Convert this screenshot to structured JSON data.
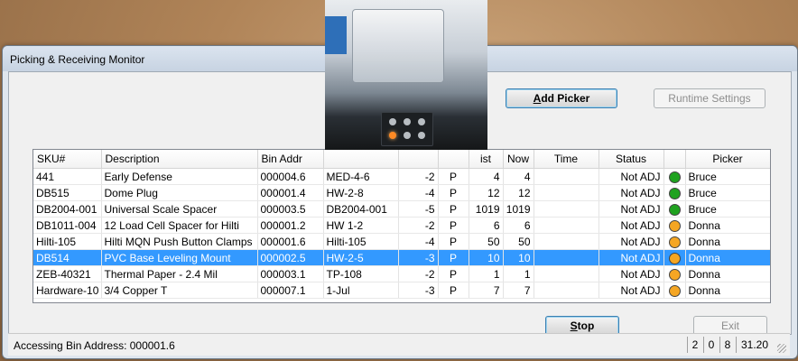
{
  "window": {
    "title": "Picking & Receiving Monitor"
  },
  "buttons": {
    "add_picker": "Add Picker",
    "runtime_settings": "Runtime Settings",
    "stop": "Stop",
    "exit": "Exit"
  },
  "grid": {
    "headers": [
      "SKU#",
      "Description",
      "Bin Addr",
      "",
      "",
      "",
      "ist",
      "Now",
      "Time",
      "Status",
      "",
      "Picker"
    ],
    "rows": [
      {
        "sku": "441",
        "desc": "Early Defense",
        "bin": "000004.6",
        "loc": "MED-4-6",
        "qty": "-2",
        "type": "P",
        "last": "4",
        "now": "4",
        "time": "",
        "status": "Not ADJ",
        "light": "green",
        "picker": "Bruce"
      },
      {
        "sku": "DB515",
        "desc": "Dome Plug",
        "bin": "000001.4",
        "loc": "HW-2-8",
        "qty": "-4",
        "type": "P",
        "last": "12",
        "now": "12",
        "time": "",
        "status": "Not ADJ",
        "light": "green",
        "picker": "Bruce"
      },
      {
        "sku": "DB2004-001",
        "desc": "Universal Scale Spacer",
        "bin": "000003.5",
        "loc": "DB2004-001",
        "qty": "-5",
        "type": "P",
        "last": "1019",
        "now": "1019",
        "time": "",
        "status": "Not ADJ",
        "light": "green",
        "picker": "Bruce"
      },
      {
        "sku": "DB1011-004",
        "desc": "12 Load Cell Spacer for Hilti",
        "bin": "000001.2",
        "loc": "HW 1-2",
        "qty": "-2",
        "type": "P",
        "last": "6",
        "now": "6",
        "time": "",
        "status": "Not ADJ",
        "light": "orange",
        "picker": "Donna"
      },
      {
        "sku": "Hilti-105",
        "desc": "Hilti MQN Push Button Clamps",
        "bin": "000001.6",
        "loc": "Hilti-105",
        "qty": "-4",
        "type": "P",
        "last": "50",
        "now": "50",
        "time": "",
        "status": "Not ADJ",
        "light": "orange",
        "picker": "Donna"
      },
      {
        "sku": "DB514",
        "desc": "PVC Base Leveling Mount",
        "bin": "000002.5",
        "loc": "HW-2-5",
        "qty": "-3",
        "type": "P",
        "last": "10",
        "now": "10",
        "time": "",
        "status": "Not ADJ",
        "light": "orange",
        "picker": "Donna"
      },
      {
        "sku": "ZEB-40321",
        "desc": "Thermal Paper - 2.4 Mil",
        "bin": "000003.1",
        "loc": "TP-108",
        "qty": "-2",
        "type": "P",
        "last": "1",
        "now": "1",
        "time": "",
        "status": "Not ADJ",
        "light": "orange",
        "picker": "Donna"
      },
      {
        "sku": "Hardware-10",
        "desc": "3/4 Copper T",
        "bin": "000007.1",
        "loc": "1-Jul",
        "qty": "-3",
        "type": "P",
        "last": "7",
        "now": "7",
        "time": "",
        "status": "Not ADJ",
        "light": "orange",
        "picker": "Donna"
      }
    ],
    "selected_row": 5
  },
  "status": {
    "message": "Accessing Bin Address: 000001.6",
    "cells": [
      "2",
      "0",
      "8",
      "31.20"
    ]
  },
  "colors": {
    "green": "#1fa21f",
    "orange": "#f5a623",
    "selection": "#3399ff"
  }
}
